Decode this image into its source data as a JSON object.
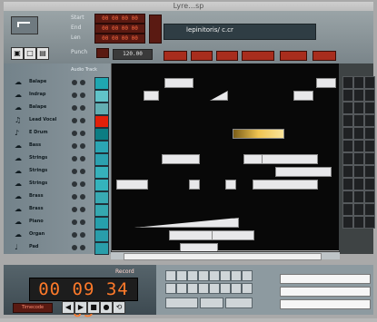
{
  "titlebar": {
    "title": "Lyre…sp"
  },
  "toolbar": {
    "locators": [
      {
        "label": "Start",
        "value": "00 00 00 00"
      },
      {
        "label": "End",
        "value": "00 00 00 00"
      },
      {
        "label": "Len",
        "value": "00 00 00 00"
      },
      {
        "label": "Punch",
        "value": "00 00 00 00"
      }
    ],
    "filename": "lepinitoris/ c.cr",
    "tempo": "120.00",
    "icons": [
      "save-icon",
      "folder-icon",
      "grid-icon"
    ]
  },
  "tracklist": {
    "column_header": "Audio Track",
    "tracks": [
      {
        "name": "Balape",
        "color": "#1fa7b1"
      },
      {
        "name": "Indrap",
        "color": "#61c3c9"
      },
      {
        "name": "Balape",
        "color": "#63aeb2"
      },
      {
        "name": "Lead Vocal",
        "color": "#e1200a"
      },
      {
        "name": "E Drum",
        "color": "#0c7d83"
      },
      {
        "name": "Bass",
        "color": "#2ba6b4"
      },
      {
        "name": "Strings",
        "color": "#2ca1af"
      },
      {
        "name": "Strings",
        "color": "#36b1bb"
      },
      {
        "name": "Strings",
        "color": "#34b3bc"
      },
      {
        "name": "Brass",
        "color": "#38aab3"
      },
      {
        "name": "Brass",
        "color": "#35a8b0"
      },
      {
        "name": "Piano",
        "color": "#26a0ac"
      },
      {
        "name": "Organ",
        "color": "#299daa"
      },
      {
        "name": "Pad",
        "color": "#2a9eaa"
      }
    ]
  },
  "arrange": {
    "regions": [
      {
        "track": 1,
        "start": 0.14,
        "end": 0.2,
        "kind": "plain"
      },
      {
        "track": 1,
        "start": 0.43,
        "end": 0.5,
        "kind": "wedge"
      },
      {
        "track": 1,
        "start": 0.8,
        "end": 0.88,
        "kind": "plain"
      },
      {
        "track": 0,
        "start": 0.23,
        "end": 0.35,
        "kind": "plain"
      },
      {
        "track": 0,
        "start": 0.9,
        "end": 0.98,
        "kind": "plain"
      },
      {
        "track": 4,
        "start": 0.53,
        "end": 0.75,
        "kind": "gold"
      },
      {
        "track": 6,
        "start": 0.22,
        "end": 0.38,
        "kind": "plain"
      },
      {
        "track": 6,
        "start": 0.58,
        "end": 0.66,
        "kind": "plain"
      },
      {
        "track": 6,
        "start": 0.66,
        "end": 0.9,
        "kind": "plain"
      },
      {
        "track": 7,
        "start": 0.72,
        "end": 0.96,
        "kind": "plain"
      },
      {
        "track": 8,
        "start": 0.02,
        "end": 0.15,
        "kind": "plain"
      },
      {
        "track": 8,
        "start": 0.34,
        "end": 0.38,
        "kind": "plain"
      },
      {
        "track": 8,
        "start": 0.5,
        "end": 0.54,
        "kind": "plain"
      },
      {
        "track": 8,
        "start": 0.62,
        "end": 0.9,
        "kind": "plain"
      },
      {
        "track": 11,
        "start": 0.1,
        "end": 0.55,
        "kind": "wedge"
      },
      {
        "track": 12,
        "start": 0.25,
        "end": 0.44,
        "kind": "plain"
      },
      {
        "track": 12,
        "start": 0.44,
        "end": 0.62,
        "kind": "plain"
      },
      {
        "track": 13,
        "start": 0.3,
        "end": 0.46,
        "kind": "plain"
      }
    ]
  },
  "transport": {
    "time": "00 09 34 05",
    "record_label": "Record",
    "clock_mode": "Timecode",
    "buttons": [
      "rewind-icon",
      "play-icon",
      "stop-icon",
      "record-icon",
      "loop-icon"
    ]
  }
}
